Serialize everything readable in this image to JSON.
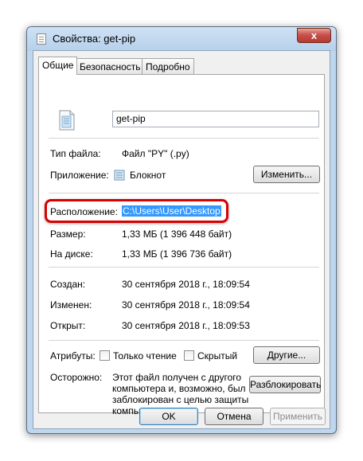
{
  "window": {
    "title": "Свойства: get-pip",
    "close_glyph": "x"
  },
  "tabs": [
    {
      "label": "Общие",
      "active": true
    },
    {
      "label": "Безопасность",
      "active": false
    },
    {
      "label": "Подробно",
      "active": false
    }
  ],
  "file": {
    "name": "get-pip"
  },
  "type_row": {
    "label": "Тип файла:",
    "value": "Файл \"PY\" (.py)"
  },
  "app_row": {
    "label": "Приложение:",
    "value": "Блокнот",
    "button": "Изменить..."
  },
  "location_row": {
    "label": "Расположение:",
    "value": "C:\\Users\\User\\Desktop"
  },
  "size_row": {
    "label": "Размер:",
    "value": "1,33 МБ (1 396 448 байт)"
  },
  "disk_row": {
    "label": "На диске:",
    "value": "1,33 МБ (1 396 736 байт)"
  },
  "created_row": {
    "label": "Создан:",
    "value": "30 сентября 2018 г., 18:09:54"
  },
  "modified_row": {
    "label": "Изменен:",
    "value": "30 сентября 2018 г., 18:09:54"
  },
  "opened_row": {
    "label": "Открыт:",
    "value": "30 сентября 2018 г., 18:09:53"
  },
  "attributes": {
    "label": "Атрибуты:",
    "readonly_label": "Только чтение",
    "readonly_checked": false,
    "hidden_label": "Скрытый",
    "hidden_checked": false,
    "other_button": "Другие..."
  },
  "warning": {
    "label": "Осторожно:",
    "lines": [
      "Этот файл получен с другого",
      "компьютера и, возможно, был",
      "заблокирован с целью защиты",
      "компьютера."
    ],
    "unblock_button": "Разблокировать"
  },
  "footer": {
    "ok": "OK",
    "cancel": "Отмена",
    "apply": "Применить"
  },
  "colors": {
    "highlight_frame": "#d90000",
    "selection": "#3399ff",
    "window_frame": "#bfd7ee"
  },
  "icons": {
    "window": "notepad-file-icon",
    "file": "py-file-icon",
    "app": "notepad-icon"
  }
}
